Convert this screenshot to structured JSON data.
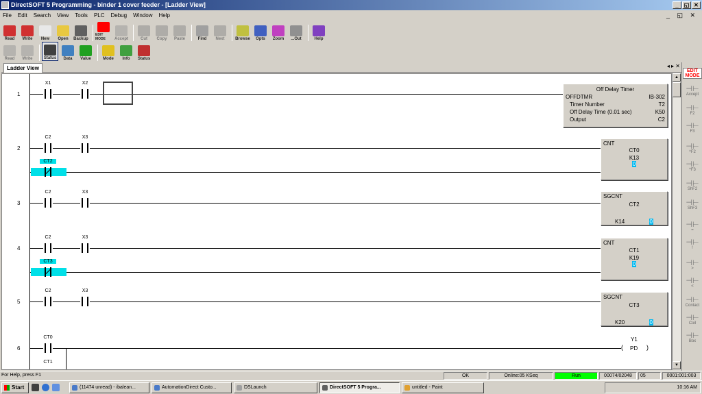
{
  "window": {
    "title": "DirectSOFT 5 Programming - binder 1 cover feeder - [Ladder View]"
  },
  "menu": [
    "File",
    "Edit",
    "Search",
    "View",
    "Tools",
    "PLC",
    "Debug",
    "Window",
    "Help"
  ],
  "toolbar1": [
    {
      "label": "Read",
      "icon": "read-icon",
      "color": "#d03030"
    },
    {
      "label": "Write",
      "icon": "write-icon",
      "color": "#d03030"
    },
    {
      "label": "New",
      "icon": "new-icon",
      "color": "#e8e8e8"
    },
    {
      "label": "Open",
      "icon": "open-icon",
      "color": "#e8c840"
    },
    {
      "label": "Backup",
      "icon": "backup-icon",
      "color": "#606060"
    },
    {
      "label": "EDIT MODE",
      "icon": "edit-mode-icon",
      "color": "#ff0000"
    },
    {
      "label": "Accept",
      "icon": "accept-icon",
      "color": "#909090",
      "disabled": true
    },
    {
      "label": "Cut",
      "icon": "cut-icon",
      "color": "#808080",
      "disabled": true
    },
    {
      "label": "Copy",
      "icon": "copy-icon",
      "color": "#808080",
      "disabled": true
    },
    {
      "label": "Paste",
      "icon": "paste-icon",
      "color": "#808080",
      "disabled": true
    },
    {
      "label": "Find",
      "icon": "find-icon",
      "color": "#a0a0a0"
    },
    {
      "label": "Next",
      "icon": "next-icon",
      "color": "#808080",
      "disabled": true
    },
    {
      "label": "Browse",
      "icon": "browse-icon",
      "color": "#c0c040"
    },
    {
      "label": "Opts",
      "icon": "opts-icon",
      "color": "#4060c0"
    },
    {
      "label": "Zoom",
      "icon": "zoom-icon",
      "color": "#c040c0"
    },
    {
      "label": "...Out",
      "icon": "zoom-out-icon",
      "color": "#909090"
    },
    {
      "label": "Help",
      "icon": "help-icon",
      "color": "#8040c0"
    }
  ],
  "toolbar2": [
    {
      "label": "Read",
      "icon": "read2-icon",
      "color": "#909090",
      "disabled": true
    },
    {
      "label": "Write",
      "icon": "write2-icon",
      "color": "#909090",
      "disabled": true
    },
    {
      "label": "Status",
      "icon": "status-icon",
      "color": "#404040",
      "active": true
    },
    {
      "label": "Data",
      "icon": "data-icon",
      "color": "#4080c0"
    },
    {
      "label": "Value",
      "icon": "value-icon",
      "color": "#20a020"
    },
    {
      "label": "Mode",
      "icon": "mode-icon",
      "color": "#e0c020"
    },
    {
      "label": "Info",
      "icon": "info-icon",
      "color": "#40a040"
    },
    {
      "label": "Status",
      "icon": "status2-icon",
      "color": "#c03030"
    }
  ],
  "tab": {
    "label": "Ladder View",
    "controls": "◂ ▸ ✕"
  },
  "rungs": [
    {
      "num": "1",
      "c1": "X1",
      "c2": "X2"
    },
    {
      "num": "2",
      "c1": "C2",
      "c2": "X3",
      "nc": "CT2"
    },
    {
      "num": "3",
      "c1": "C2",
      "c2": "X3"
    },
    {
      "num": "4",
      "c1": "C2",
      "c2": "X3",
      "nc": "CT3"
    },
    {
      "num": "5",
      "c1": "C2",
      "c2": "X3"
    },
    {
      "num": "6",
      "c1": "CT0",
      "c2": "CT1"
    }
  ],
  "boxes": {
    "timer": {
      "title": "Off Delay Timer",
      "type": "OFFDTMR",
      "ib": "IB-302",
      "timer_label": "Timer Number",
      "timer_value": "T2",
      "delay_label": "Off Delay Time (0.01 sec)",
      "delay_value": "K50",
      "output_label": "Output",
      "output_value": "C2"
    },
    "cnt1": {
      "type": "CNT",
      "name": "CT0",
      "preset": "K13",
      "value": "0"
    },
    "sgcnt1": {
      "type": "SGCNT",
      "name": "CT2",
      "preset": "K14",
      "value": "0"
    },
    "cnt2": {
      "type": "CNT",
      "name": "CT1",
      "preset": "K19",
      "value": "0"
    },
    "sgcnt2": {
      "type": "SGCNT",
      "name": "CT3",
      "preset": "K20",
      "value": "0"
    },
    "coil": {
      "name": "Y1",
      "mode": "PD",
      "open": "(",
      "close": ")"
    }
  },
  "rightpanel": [
    {
      "label": "EDIT\nMODE"
    },
    {
      "label": "Accept"
    },
    {
      "label": "F2"
    },
    {
      "label": "F3"
    },
    {
      "label": "^F2"
    },
    {
      "label": "^F3"
    },
    {
      "label": "ShF2"
    },
    {
      "label": "ShF3"
    },
    {
      "label": "="
    },
    {
      "label": "!"
    },
    {
      "label": ">"
    },
    {
      "label": "<"
    },
    {
      "label": "Contact"
    },
    {
      "label": "Coil"
    },
    {
      "label": "Box"
    }
  ],
  "status": {
    "help": "For Help, press F1",
    "ok": "OK",
    "online": "Online:05 KSeq",
    "run": "Run",
    "mem": "00074/02048",
    "n": "05",
    "addr": "0001:001:003",
    "run_color": "#00ff00"
  },
  "taskbar": {
    "start": "Start",
    "tasks": [
      "(11474 unread) - ibalean...",
      "AutomationDirect Custo...",
      "DSLaunch",
      "DirectSOFT 5 Progra...",
      "untitled - Paint"
    ],
    "time": "10:16 AM"
  }
}
